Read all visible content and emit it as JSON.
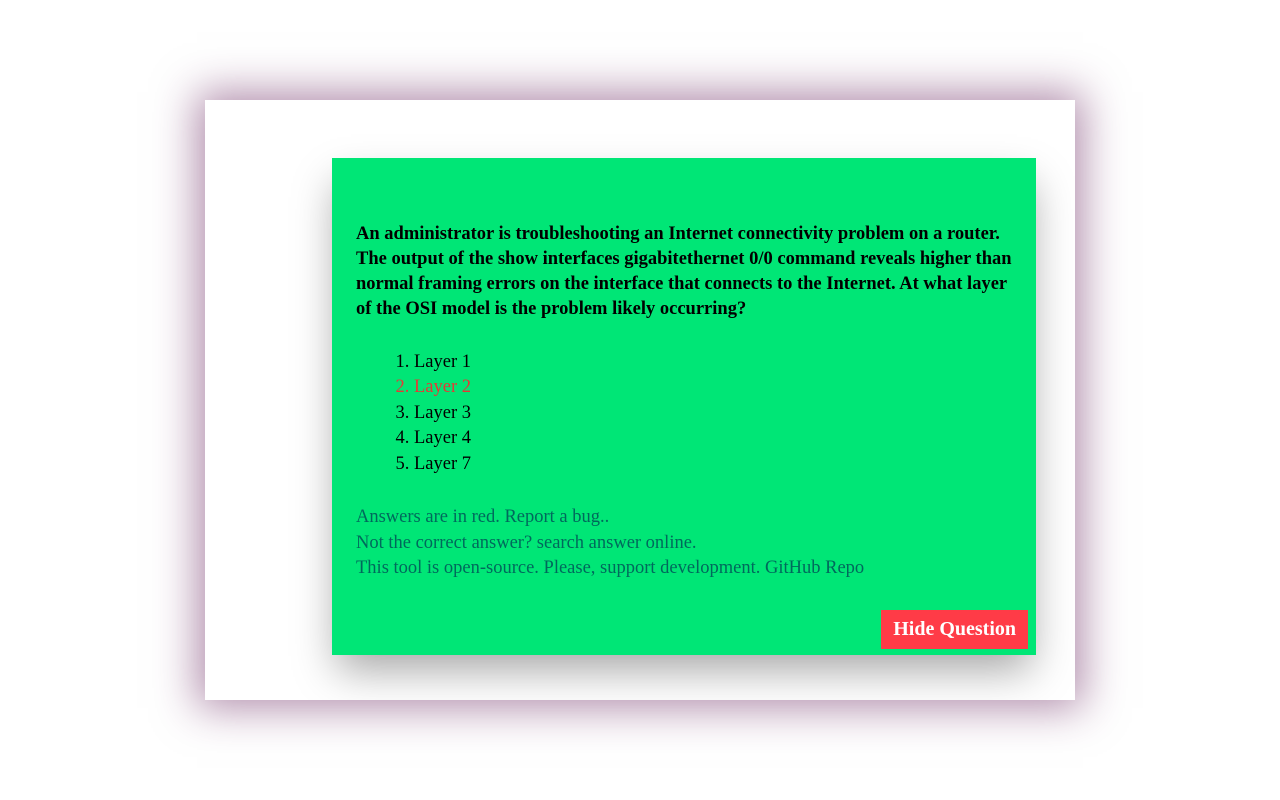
{
  "question": {
    "text": "An administrator is troubleshooting an Internet connectivity problem on a router. The output of the show interfaces gigabitethernet 0/0 command reveals higher than normal framing errors on the interface that connects to the Internet. At what layer of the OSI model is the problem likely occurring?",
    "options": [
      {
        "label": "Layer 1",
        "correct": false
      },
      {
        "label": "Layer 2",
        "correct": true
      },
      {
        "label": "Layer 3",
        "correct": false
      },
      {
        "label": "Layer 4",
        "correct": false
      },
      {
        "label": "Layer 7",
        "correct": false
      }
    ]
  },
  "footer": {
    "line1": "Answers are in red. Report a bug..",
    "line2": "Not the correct answer?  search answer online.",
    "line3": "This tool is open-source. Please, support development. GitHub Repo"
  },
  "buttons": {
    "hide_question": "Hide Question"
  }
}
